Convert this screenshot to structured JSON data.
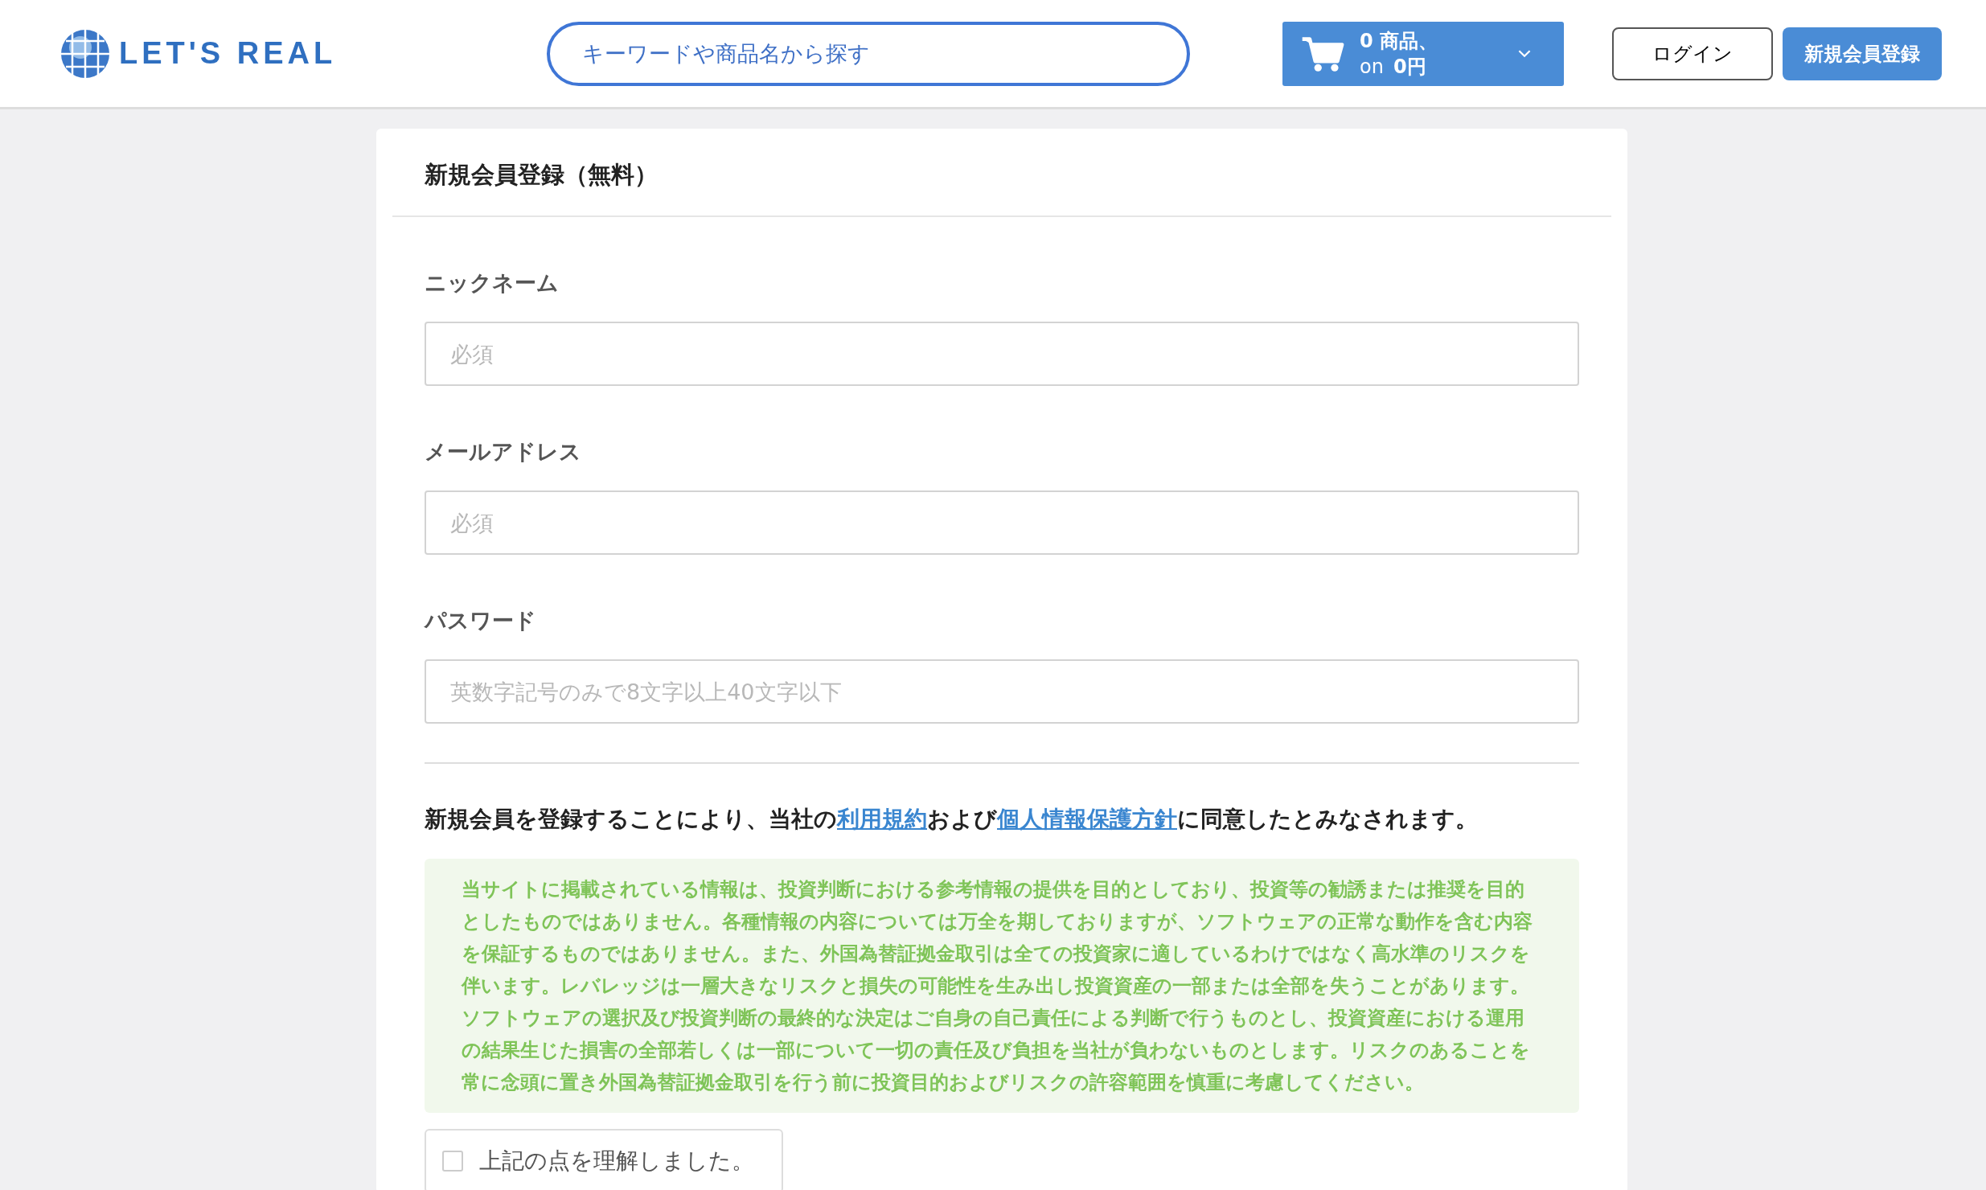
{
  "header": {
    "logo_text": "LET'S REAL",
    "search": {
      "placeholder": "キーワードや商品名から探す"
    },
    "cart": {
      "count_line": "0 商品、",
      "total_prefix": "on",
      "total": "0円"
    },
    "login_button": "ログイン",
    "register_button": "新規会員登録"
  },
  "form": {
    "title": "新規会員登録（無料）",
    "fields": [
      {
        "label": "ニックネーム",
        "placeholder": "必須"
      },
      {
        "label": "メールアドレス",
        "placeholder": "必須"
      },
      {
        "label": "パスワード",
        "placeholder": "英数字記号のみで8文字以上40文字以下"
      }
    ],
    "consent": [
      {
        "kind": "text",
        "text": "新規会員を登録することにより、当社の"
      },
      {
        "kind": "link",
        "text": "利用規約"
      },
      {
        "kind": "text",
        "text": "および"
      },
      {
        "kind": "link",
        "text": "個人情報保護方針"
      },
      {
        "kind": "text",
        "text": "に同意したとみなされます。"
      }
    ],
    "disclaimer": "当サイトに掲載されている情報は、投資判断における参考情報の提供を目的としており、投資等の勧誘または推奨を目的としたものではありません。各種情報の内容については万全を期しておりますが、ソフトウェアの正常な動作を含む内容を保証するものではありません。また、外国為替証拠金取引は全ての投資家に適しているわけではなく高水準のリスクを伴います。レバレッジは一層大きなリスクと損失の可能性を生み出し投資資産の一部または全部を失うことがあります。ソフトウェアの選択及び投資判断の最終的な決定はご自身の自己責任による判断で行うものとし、投資資産における運用の結果生じた損害の全部若しくは一部について一切の責任及び負担を当社が負わないものとします。リスクのあることを常に念頭に置き外国為替証拠金取引を行う前に投資目的およびリスクの許容範囲を慎重に考慮してください。",
    "agree": {
      "label": "上記の点を理解しました。",
      "checked": false
    }
  }
}
